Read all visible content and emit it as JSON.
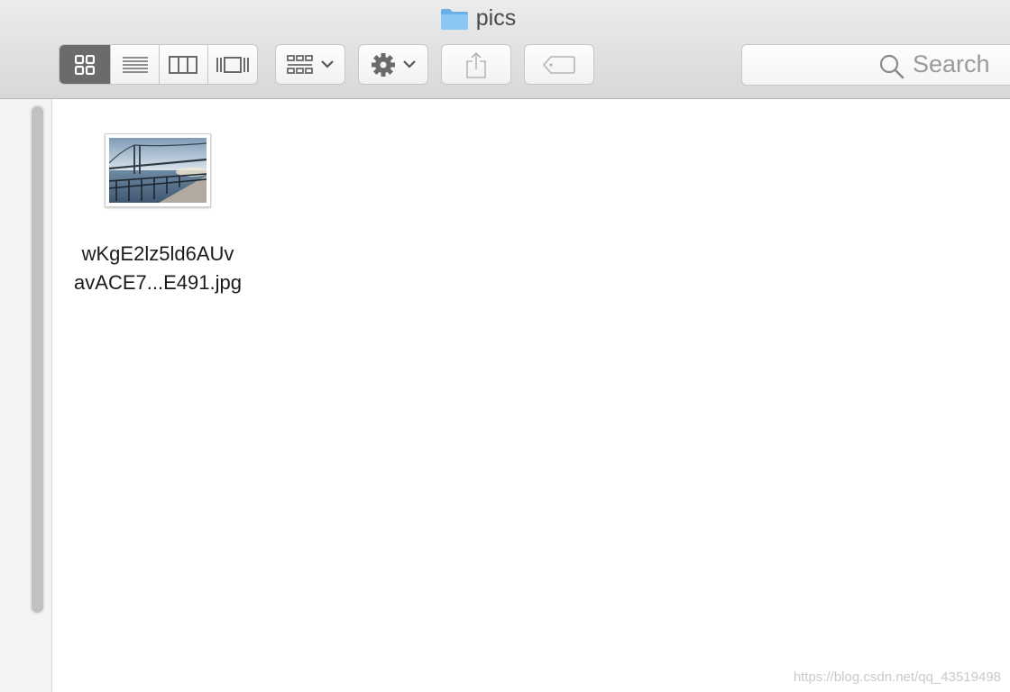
{
  "window": {
    "title": "pics"
  },
  "toolbar": {
    "view_modes": [
      {
        "name": "icon-view",
        "active": true
      },
      {
        "name": "list-view",
        "active": false
      },
      {
        "name": "column-view",
        "active": false
      },
      {
        "name": "cover-flow-view",
        "active": false
      }
    ],
    "group_button": {
      "icon": "grid-group-icon",
      "has_dropdown": true
    },
    "action_button": {
      "icon": "gear-icon",
      "has_dropdown": true
    },
    "share_button": {
      "icon": "share-icon"
    },
    "tags_button": {
      "icon": "tag-icon"
    }
  },
  "search": {
    "placeholder": "Search"
  },
  "files": [
    {
      "name_line1": "wKgE2lz5ld6AUv",
      "name_line2": "avACE7...E491.jpg",
      "thumbnail": "bridge-photo"
    }
  ],
  "watermark": "https://blog.csdn.net/qq_43519498",
  "colors": {
    "folder": "#6ab0e8",
    "active_segment": "#6b6b6b",
    "toolbar_bg": "#e2e2e2"
  }
}
